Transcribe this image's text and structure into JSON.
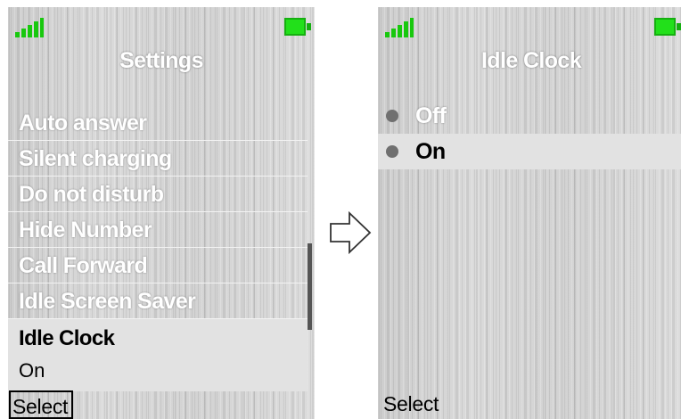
{
  "left_screen": {
    "title": "Settings",
    "menu_items": [
      {
        "label": "Auto answer"
      },
      {
        "label": "Silent charging"
      },
      {
        "label": "Do not disturb"
      },
      {
        "label": "Hide Number"
      },
      {
        "label": "Call Forward"
      },
      {
        "label": "Idle Screen Saver"
      }
    ],
    "selected_item": {
      "label": "Idle Clock",
      "value": "On"
    },
    "softkey": "Select",
    "icons": {
      "signal": "signal-strength-icon",
      "battery": "battery-full-icon"
    }
  },
  "right_screen": {
    "title": "Idle Clock",
    "options": [
      {
        "label": "Off",
        "selected": false
      },
      {
        "label": "On",
        "selected": true
      }
    ],
    "softkey": "Select",
    "icons": {
      "signal": "signal-strength-icon",
      "battery": "battery-full-icon",
      "radio": "radio-button-icon"
    }
  },
  "transition_icon": "right-arrow-icon",
  "colors": {
    "signal": "#18c80e",
    "battery": "#22e01a",
    "highlight": "#e2e2e2",
    "text": "#ffffff"
  }
}
